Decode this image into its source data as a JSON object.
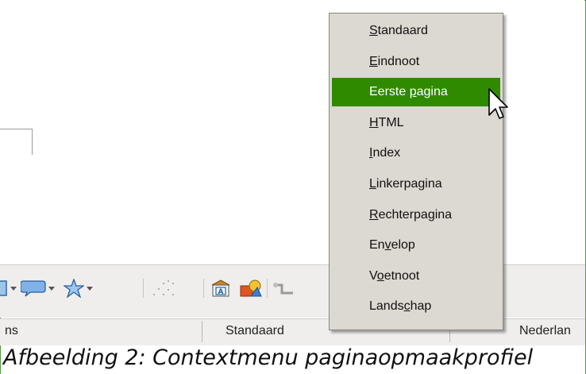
{
  "menu": {
    "items": [
      {
        "label": "Standaard",
        "mnemonic_index": 0
      },
      {
        "label": "Eindnoot",
        "mnemonic_index": 0
      },
      {
        "label": "Eerste pagina",
        "mnemonic_index": 7,
        "active": true
      },
      {
        "label": "HTML",
        "mnemonic_index": 0
      },
      {
        "label": "Index",
        "mnemonic_index": 0
      },
      {
        "label": "Linkerpagina",
        "mnemonic_index": 0
      },
      {
        "label": "Rechterpagina",
        "mnemonic_index": 0
      },
      {
        "label": "Envelop",
        "mnemonic_index": 2
      },
      {
        "label": "Voetnoot",
        "mnemonic_index": 1
      },
      {
        "label": "Landschap",
        "mnemonic_index": 5
      }
    ]
  },
  "statusbar": {
    "left_text": "ns",
    "page_style": "Standaard",
    "language": "Nederlan"
  },
  "caption": "Afbeelding 2: Contextmenu paginaopmaakprofiel",
  "colors": {
    "menu_bg": "#dcd8d2",
    "highlight": "#2f8a00",
    "toolbar_bg": "#efeeec"
  },
  "toolbar": {
    "icons": [
      "table-icon",
      "callout-icon",
      "star-icon",
      "points-icon",
      "fontwork-gallery-icon",
      "insert-shape-icon",
      "connector-icon"
    ]
  }
}
